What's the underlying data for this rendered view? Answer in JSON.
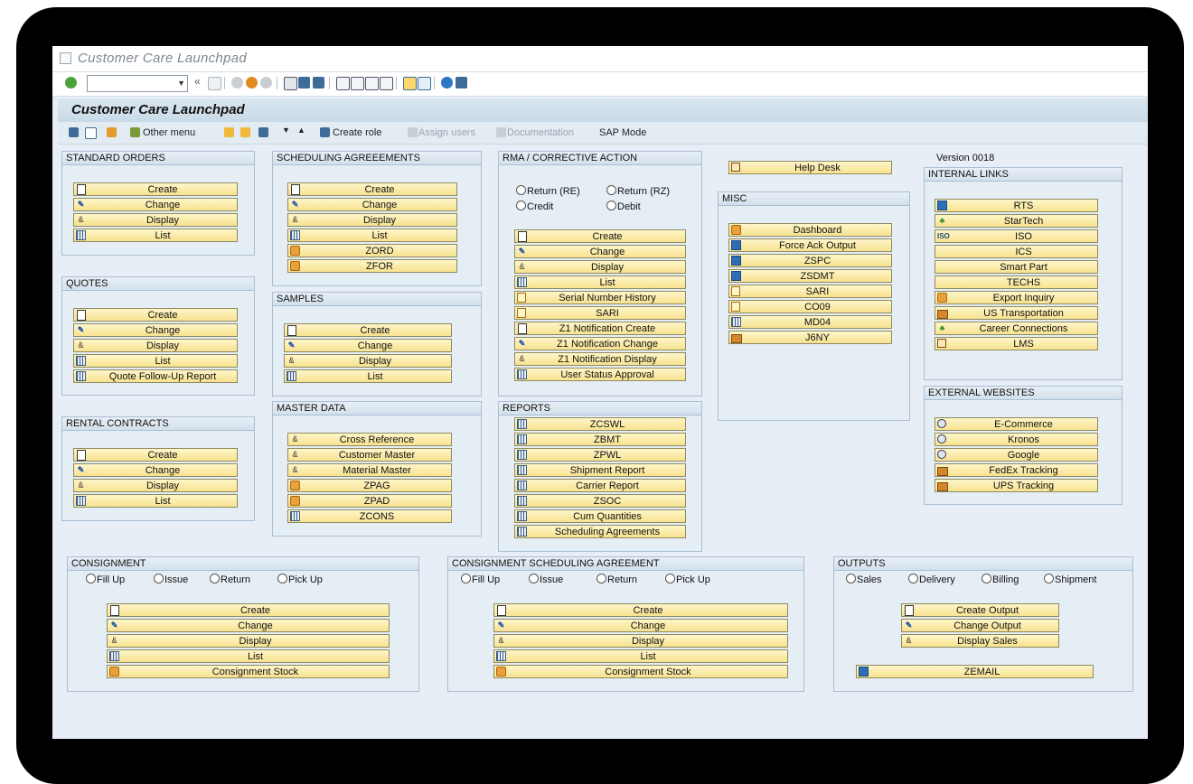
{
  "window": {
    "title": "Customer Care Launchpad"
  },
  "header": {
    "title": "Customer Care Launchpad"
  },
  "app_toolbar": {
    "other_menu": "Other menu",
    "create_role": "Create role",
    "assign_users": "Assign users",
    "documentation": "Documentation",
    "sap_mode": "SAP Mode"
  },
  "version": "Version 0018",
  "groups": {
    "standard_orders": {
      "title": "STANDARD ORDERS",
      "buttons": [
        "Create",
        "Change",
        "Display",
        "List"
      ]
    },
    "quotes": {
      "title": "QUOTES",
      "buttons": [
        "Create",
        "Change",
        "Display",
        "List",
        "Quote Follow-Up Report"
      ]
    },
    "rental_contracts": {
      "title": "RENTAL CONTRACTS",
      "buttons": [
        "Create",
        "Change",
        "Display",
        "List"
      ]
    },
    "scheduling_agreements": {
      "title": "SCHEDULING AGREEEMENTS",
      "buttons": [
        "Create",
        "Change",
        "Display",
        "List",
        "ZORD",
        "ZFOR"
      ]
    },
    "samples": {
      "title": "SAMPLES",
      "buttons": [
        "Create",
        "Change",
        "Display",
        "List"
      ]
    },
    "master_data": {
      "title": "MASTER DATA",
      "buttons": [
        "Cross Reference",
        "Customer Master",
        "Material Master",
        "ZPAG",
        "ZPAD",
        "ZCONS"
      ]
    },
    "rma": {
      "title": "RMA / CORRECTIVE ACTION",
      "radios": [
        "Return (RE)",
        "Return (RZ)",
        "Credit",
        "Debit"
      ],
      "buttons": [
        "Create",
        "Change",
        "Display",
        "List",
        "Serial Number History",
        "SARI",
        "Z1 Notification Create",
        "Z1 Notification Change",
        "Z1 Notification Display",
        "User Status Approval"
      ]
    },
    "reports": {
      "title": "REPORTS",
      "buttons": [
        "ZCSWL",
        "ZBMT",
        "ZPWL",
        "Shipment Report",
        "Carrier Report",
        "ZSOC",
        "Cum Quantities",
        "Scheduling Agreements"
      ]
    },
    "help_desk": {
      "label": "Help Desk"
    },
    "misc": {
      "title": "MISC",
      "buttons": [
        "Dashboard",
        "Force Ack Output",
        "ZSPC",
        "ZSDMT",
        "SARI",
        "CO09",
        "MD04",
        "J6NY"
      ]
    },
    "internal_links": {
      "title": "INTERNAL LINKS",
      "buttons": [
        "RTS",
        "StarTech",
        "ISO",
        "ICS",
        "Smart Part",
        "TECHS",
        "Export Inquiry",
        "US Transportation",
        "Career Connections",
        "LMS"
      ]
    },
    "external_websites": {
      "title": "EXTERNAL WEBSITES",
      "buttons": [
        "E-Commerce",
        "Kronos",
        "Google",
        "FedEx Tracking",
        "UPS Tracking"
      ]
    },
    "consignment": {
      "title": "CONSIGNMENT",
      "radios": [
        "Fill Up",
        "Issue",
        "Return",
        "Pick Up"
      ],
      "buttons": [
        "Create",
        "Change",
        "Display",
        "List",
        "Consignment Stock"
      ]
    },
    "consignment_sched": {
      "title": "CONSIGNMENT SCHEDULING AGREEMENT",
      "radios": [
        "Fill Up",
        "Issue",
        "Return",
        "Pick Up"
      ],
      "buttons": [
        "Create",
        "Change",
        "Display",
        "List",
        "Consignment Stock"
      ]
    },
    "outputs": {
      "title": "OUTPUTS",
      "radios": [
        "Sales",
        "Delivery",
        "Billing",
        "Shipment"
      ],
      "buttons": [
        "Create Output",
        "Change Output",
        "Display Sales",
        "ZEMAIL"
      ]
    }
  }
}
